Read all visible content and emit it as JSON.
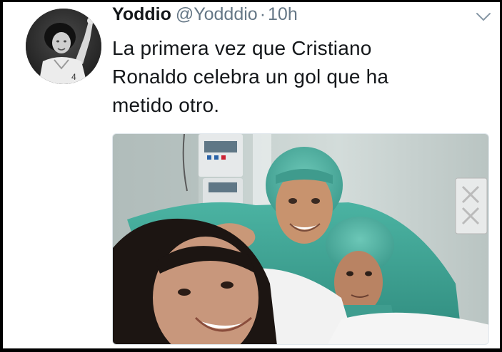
{
  "tweet": {
    "display_name": "Yoddio",
    "handle": "@Yodddio",
    "separator": "·",
    "time": "10h",
    "text_lines": [
      "La primera vez que Cristiano",
      "Ronaldo celebra un gol que ha",
      "metido otro."
    ]
  },
  "icons": {
    "menu": "chevron-down-icon"
  },
  "colors": {
    "name": "#14171a",
    "meta": "#657786",
    "scrub_green": "#3fa595",
    "wall": "#c9d3d1"
  }
}
